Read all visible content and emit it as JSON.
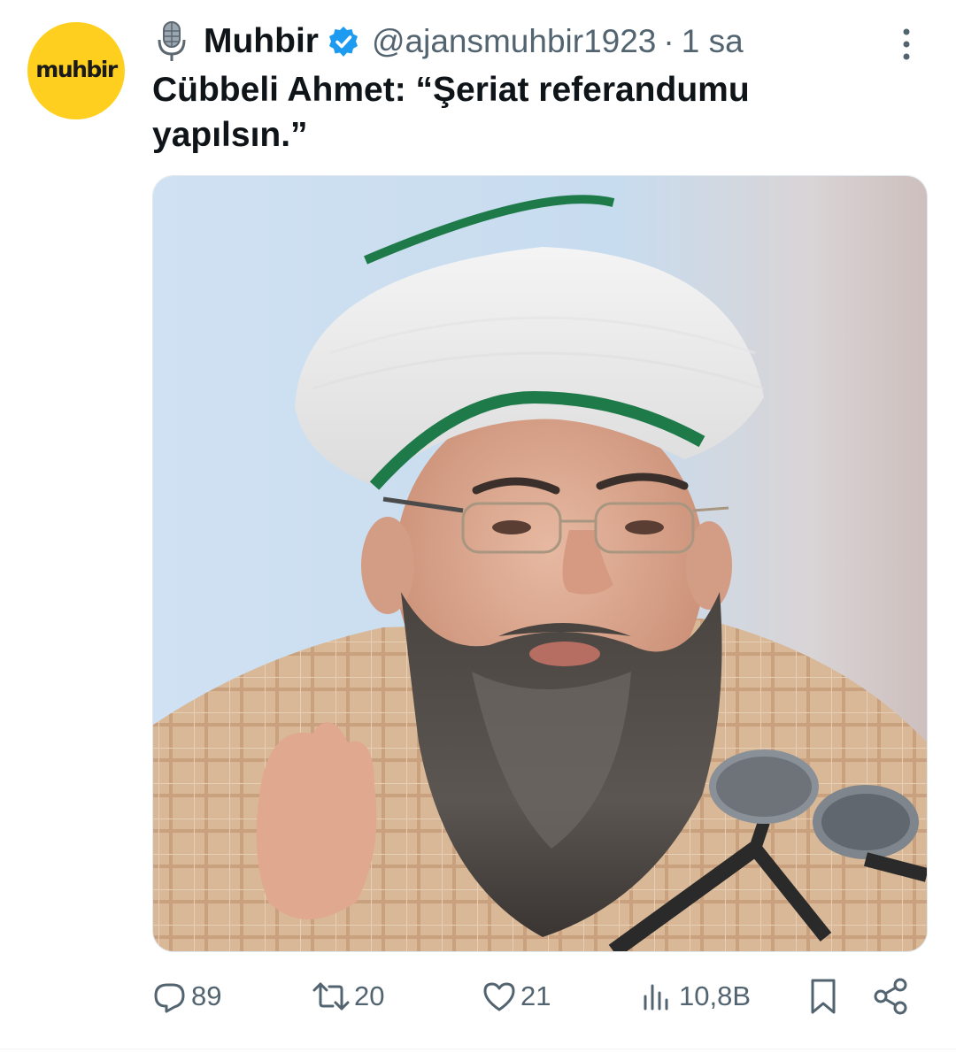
{
  "author": {
    "avatar_text": "muhbir",
    "avatar_color": "#ffcf1f",
    "name_prefix_icon": "microphone-icon",
    "display_name": "Muhbir",
    "verified": true,
    "verified_color": "#1d9bf0",
    "handle": "@ajansmuhbir1923",
    "separator": "·",
    "time": "1 sa"
  },
  "tweet": {
    "text": "Cübbeli Ahmet: “Şeriat referandumu yapılsın.”"
  },
  "media": {
    "type": "photo"
  },
  "actions": {
    "replies": "89",
    "retweets": "20",
    "likes": "21",
    "views": "10,8B",
    "icons": [
      "reply-icon",
      "retweet-icon",
      "like-icon",
      "views-icon",
      "bookmark-icon",
      "share-icon"
    ]
  },
  "colors": {
    "text_primary": "#0f1419",
    "text_secondary": "#536471",
    "accent": "#1d9bf0"
  }
}
